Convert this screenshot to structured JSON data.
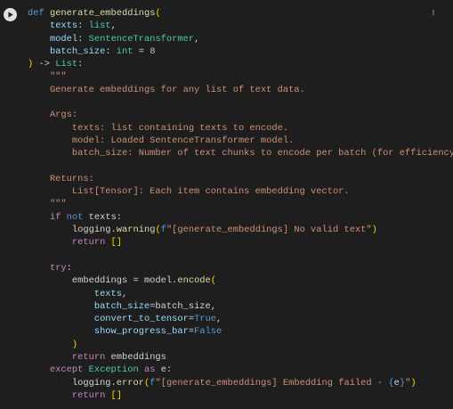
{
  "cell": {
    "run_icon": "play-icon",
    "colors": {
      "background": "#1e1e1e",
      "keyword": "#569cd6",
      "control": "#c586c0",
      "function": "#dcdcaa",
      "parameter": "#9cdcfe",
      "type": "#4ec9b0",
      "string": "#ce9178",
      "number": "#b5cea8",
      "bracket_1": "#ffd700",
      "bracket_2": "#da70d6",
      "bracket_3": "#179fff"
    },
    "lines": [
      [
        [
          "k",
          "def "
        ],
        [
          "f",
          "generate_embeddings"
        ],
        [
          "y",
          "("
        ]
      ],
      [
        [
          "x",
          "    "
        ],
        [
          "p",
          "texts"
        ],
        [
          "x",
          ": "
        ],
        [
          "t",
          "list"
        ],
        [
          "x",
          ","
        ]
      ],
      [
        [
          "x",
          "    "
        ],
        [
          "p",
          "model"
        ],
        [
          "x",
          ": "
        ],
        [
          "t",
          "SentenceTransformer"
        ],
        [
          "x",
          ","
        ]
      ],
      [
        [
          "x",
          "    "
        ],
        [
          "p",
          "batch_size"
        ],
        [
          "x",
          ": "
        ],
        [
          "t",
          "int"
        ],
        [
          "x",
          " = "
        ],
        [
          "n",
          "8"
        ]
      ],
      [
        [
          "y",
          ")"
        ],
        [
          "x",
          " -> "
        ],
        [
          "t",
          "List"
        ],
        [
          "x",
          ":"
        ]
      ],
      [
        [
          "s",
          "    \"\"\""
        ]
      ],
      [
        [
          "s",
          "    Generate embeddings for any list of text data."
        ]
      ],
      [],
      [
        [
          "s",
          "    Args:"
        ]
      ],
      [
        [
          "s",
          "        texts: list containing texts to encode."
        ]
      ],
      [
        [
          "s",
          "        model: Loaded SentenceTransformer model."
        ]
      ],
      [
        [
          "s",
          "        batch_size: Number of text chunks to encode per batch (for efficiency)."
        ]
      ],
      [],
      [
        [
          "s",
          "    Returns:"
        ]
      ],
      [
        [
          "s",
          "        List[Tensor]: Each item contains embedding vector."
        ]
      ],
      [
        [
          "s",
          "    \"\"\""
        ]
      ],
      [
        [
          "x",
          "    "
        ],
        [
          "c",
          "if "
        ],
        [
          "k",
          "not "
        ],
        [
          "x",
          "texts:"
        ]
      ],
      [
        [
          "x",
          "        logging."
        ],
        [
          "f",
          "warning"
        ],
        [
          "y",
          "("
        ],
        [
          "k",
          "f"
        ],
        [
          "s",
          "\"[generate_embeddings] No valid text\""
        ],
        [
          "y",
          ")"
        ]
      ],
      [
        [
          "x",
          "        "
        ],
        [
          "c",
          "return "
        ],
        [
          "y",
          "[]"
        ]
      ],
      [],
      [
        [
          "x",
          "    "
        ],
        [
          "c",
          "try"
        ],
        [
          "x",
          ":"
        ]
      ],
      [
        [
          "x",
          "        embeddings = model."
        ],
        [
          "f",
          "encode"
        ],
        [
          "y",
          "("
        ]
      ],
      [
        [
          "x",
          "            "
        ],
        [
          "p",
          "texts"
        ],
        [
          "x",
          ","
        ]
      ],
      [
        [
          "x",
          "            "
        ],
        [
          "p",
          "batch_size"
        ],
        [
          "x",
          "=batch_size,"
        ]
      ],
      [
        [
          "x",
          "            "
        ],
        [
          "p",
          "convert_to_tensor"
        ],
        [
          "x",
          "="
        ],
        [
          "k",
          "True"
        ],
        [
          "x",
          ","
        ]
      ],
      [
        [
          "x",
          "            "
        ],
        [
          "p",
          "show_progress_bar"
        ],
        [
          "x",
          "="
        ],
        [
          "k",
          "False"
        ]
      ],
      [
        [
          "x",
          "        "
        ],
        [
          "y",
          ")"
        ]
      ],
      [
        [
          "x",
          "        "
        ],
        [
          "c",
          "return "
        ],
        [
          "x",
          "embeddings"
        ]
      ],
      [
        [
          "x",
          "    "
        ],
        [
          "c",
          "except "
        ],
        [
          "t",
          "Exception "
        ],
        [
          "c",
          "as "
        ],
        [
          "x",
          "e:"
        ]
      ],
      [
        [
          "x",
          "        logging."
        ],
        [
          "f",
          "error"
        ],
        [
          "y",
          "("
        ],
        [
          "k",
          "f"
        ],
        [
          "s",
          "\"[generate_embeddings] Embedding failed - "
        ],
        [
          "k",
          "{"
        ],
        [
          "x",
          "e"
        ],
        [
          "k",
          "}"
        ],
        [
          "s",
          "\""
        ],
        [
          "y",
          ")"
        ]
      ],
      [
        [
          "x",
          "        "
        ],
        [
          "c",
          "return "
        ],
        [
          "y",
          "[]"
        ]
      ]
    ]
  }
}
